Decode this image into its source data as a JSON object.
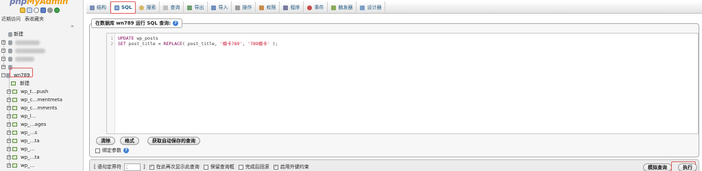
{
  "nav": {
    "logo": "phpMyAdmin",
    "quick_icons": [
      "home-icon",
      "exit-icon",
      "help-icon",
      "docs-icon",
      "settings-icon",
      "reload-icon"
    ],
    "tabs": [
      "近期访问",
      "表收藏夹"
    ],
    "link_label": "∞",
    "new_label": "新建",
    "current_db": "wn789",
    "db_new_label": "新建",
    "tables": [
      "wp_t…push",
      "wp_c…mentmeta",
      "wp_c…mments",
      "wp_l…",
      "wp_…ages",
      "wp_…s",
      "wp_…ta",
      "wp_…",
      "wp_…ta",
      "wp_…"
    ]
  },
  "menubar": {
    "items": [
      {
        "label": "结构",
        "icon": "structure-icon"
      },
      {
        "label": "SQL",
        "icon": "sql-icon",
        "active": true
      },
      {
        "label": "搜索",
        "icon": "search-icon"
      },
      {
        "label": "查询",
        "icon": "query-icon"
      },
      {
        "label": "导出",
        "icon": "export-icon"
      },
      {
        "label": "导入",
        "icon": "import-icon"
      },
      {
        "label": "操作",
        "icon": "operations-icon"
      },
      {
        "label": "权限",
        "icon": "privileges-icon"
      },
      {
        "label": "程序",
        "icon": "routines-icon"
      },
      {
        "label": "事件",
        "icon": "events-icon"
      },
      {
        "label": "触发器",
        "icon": "triggers-icon"
      },
      {
        "label": "设计器",
        "icon": "designer-icon"
      }
    ]
  },
  "sql_panel": {
    "legend": "在数据库 wn789 运行 SQL 查询:",
    "line_numbers": [
      "1",
      "2"
    ],
    "code": {
      "l1_kw": "UPDATE",
      "l1_rest": " wp_posts",
      "l2_kw": "SET",
      "l2_mid": " post_title = ",
      "l2_fn": "REPLACE",
      "l2_args": "( post_title, ",
      "l2_s1": "'楠卡789'",
      "l2_sep": ", ",
      "l2_s2": "'789楠卡'",
      "l2_end": " );"
    },
    "buttons": {
      "clear": "清除",
      "format": "格式",
      "autosave": "获取自动保存的查询"
    },
    "bind_params_label": "绑定参数"
  },
  "bottom_bar": {
    "delimiter_label": "[ 语句定界符",
    "delimiter_value": ";",
    "delimiter_close": "]",
    "options": [
      {
        "label": "在此再次显示此查询",
        "checked": true
      },
      {
        "label": "保留查询框",
        "checked": false
      },
      {
        "label": "完成后回滚",
        "checked": false
      },
      {
        "label": "启用外键约束",
        "checked": true
      }
    ],
    "simulate_label": "模拟查询",
    "go_label": "执行"
  }
}
